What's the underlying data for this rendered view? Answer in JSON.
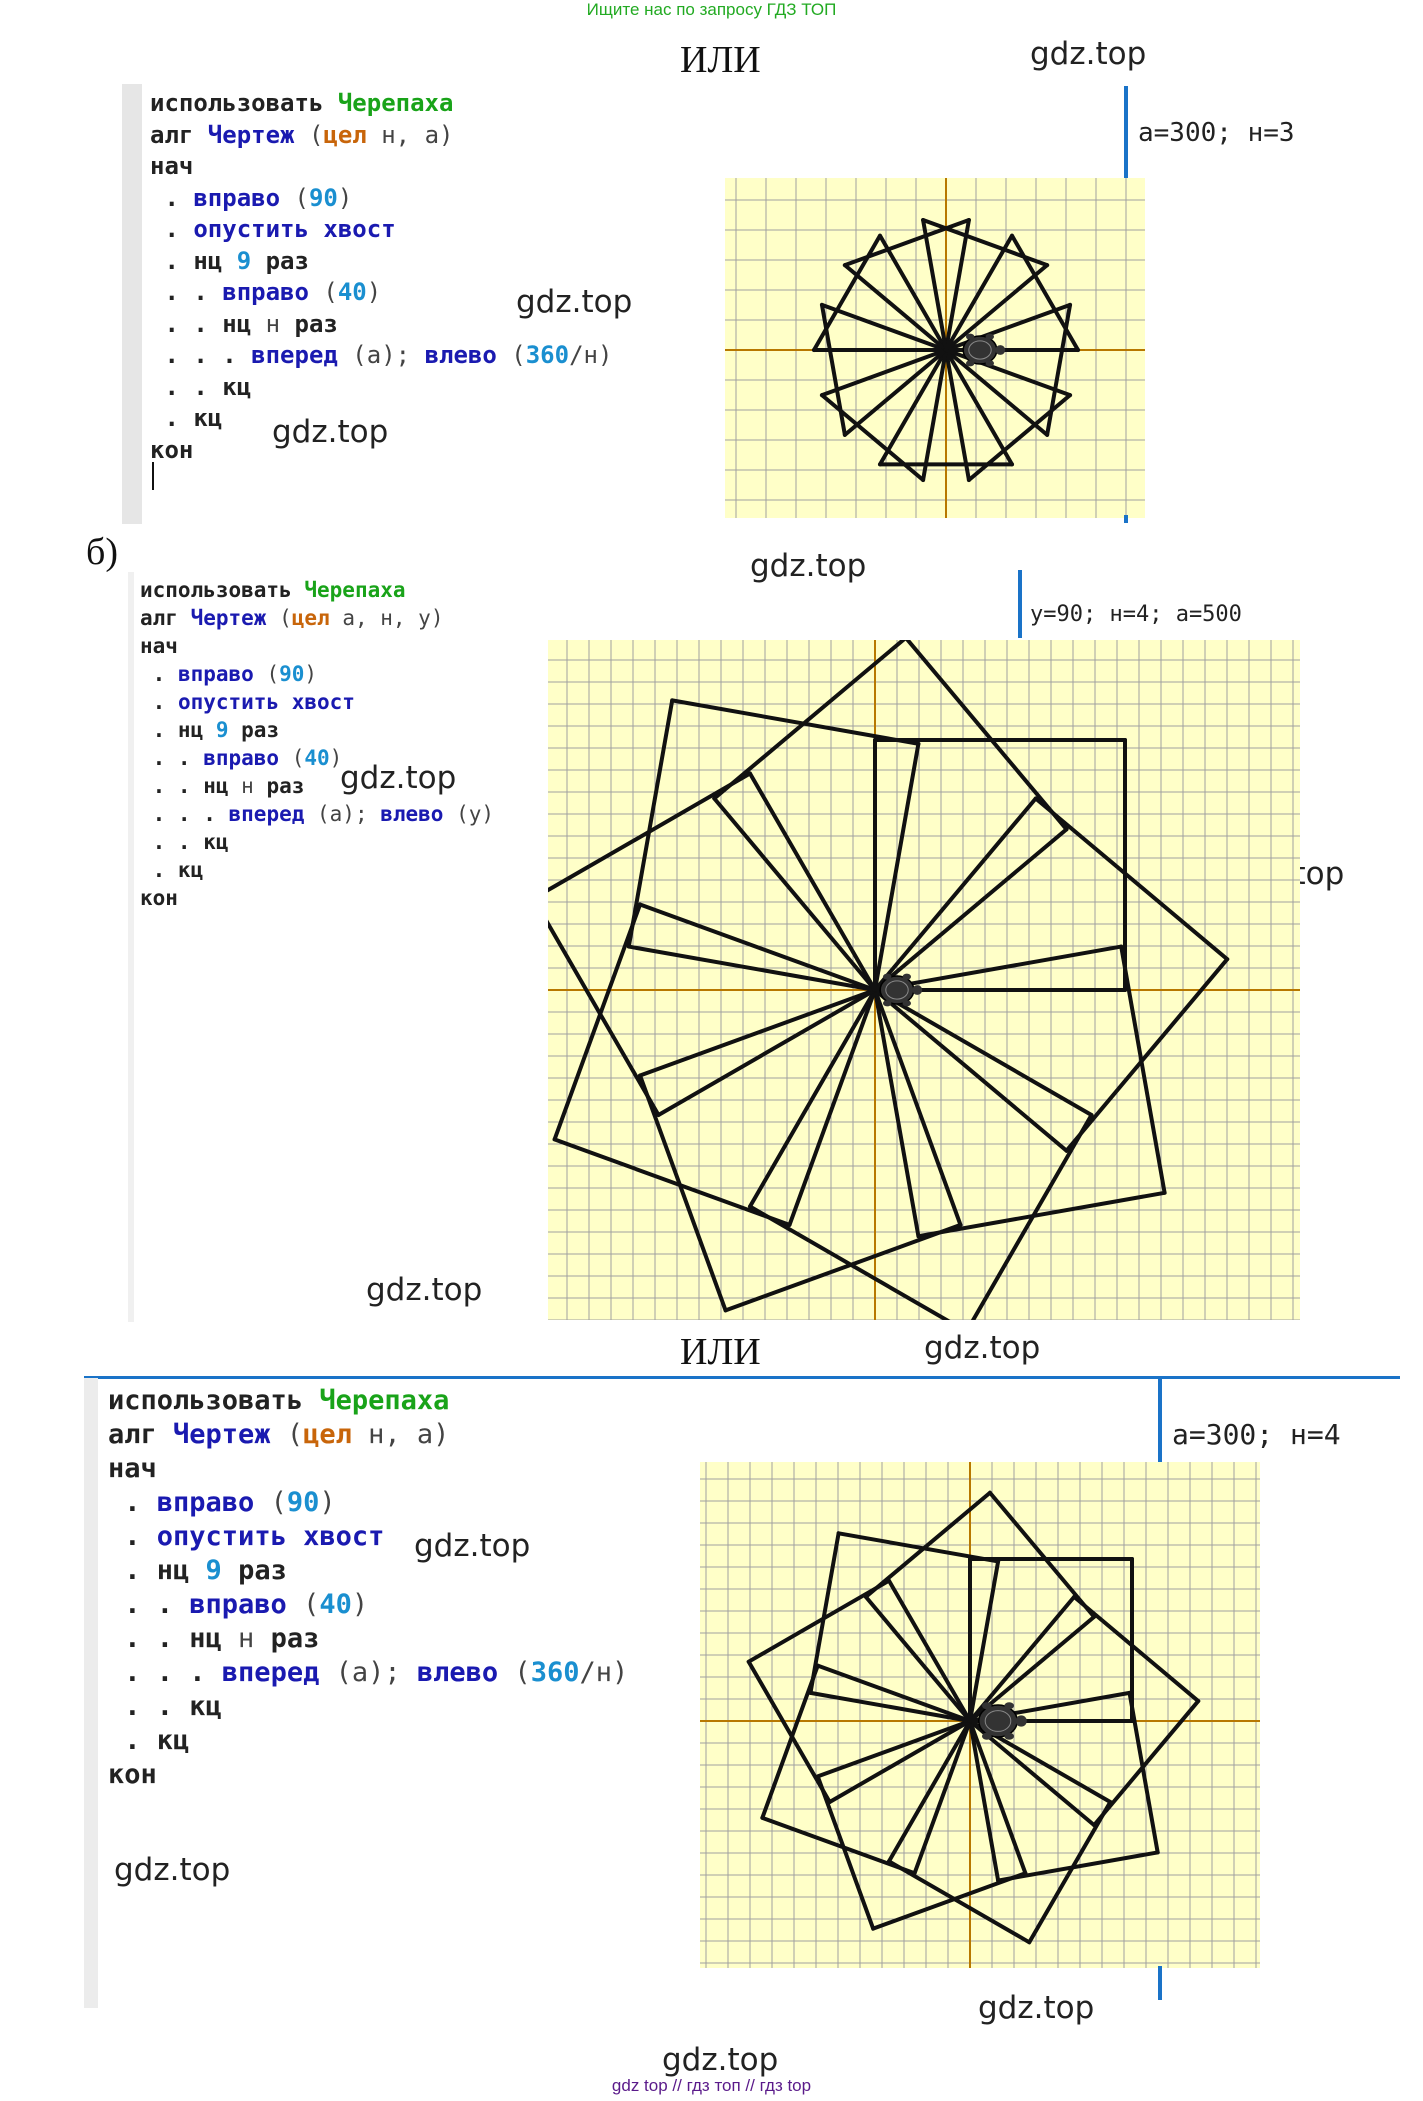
{
  "banner": "Ищите нас по запросу ГДЗ ТОП",
  "footer": "gdz top  //  гдз топ  //  гдз top",
  "or_label": "ИЛИ",
  "section_b_label": "б)",
  "watermark": "gdz.top",
  "block1": {
    "params": "a=300; н=3",
    "lines": [
      {
        "parts": [
          {
            "t": "использовать ",
            "c": "kw"
          },
          {
            "t": "Черепаха",
            "c": "grn"
          }
        ]
      },
      {
        "parts": [
          {
            "t": "алг ",
            "c": "kw"
          },
          {
            "t": "Чертеж",
            "c": "blu"
          },
          {
            "t": " (",
            "c": "plain"
          },
          {
            "t": "цел",
            "c": "org"
          },
          {
            "t": " н, а)",
            "c": "plain"
          }
        ]
      },
      {
        "parts": [
          {
            "t": "нач",
            "c": "kw"
          }
        ]
      },
      {
        "parts": [
          {
            "t": " . ",
            "c": "kw"
          },
          {
            "t": "вправо",
            "c": "blu"
          },
          {
            "t": " (",
            "c": "plain"
          },
          {
            "t": "90",
            "c": "num"
          },
          {
            "t": ")",
            "c": "plain"
          }
        ]
      },
      {
        "parts": [
          {
            "t": " . ",
            "c": "kw"
          },
          {
            "t": "опустить хвост",
            "c": "blu"
          }
        ]
      },
      {
        "parts": [
          {
            "t": " . нц ",
            "c": "kw"
          },
          {
            "t": "9",
            "c": "num"
          },
          {
            "t": " раз",
            "c": "kw"
          }
        ]
      },
      {
        "parts": [
          {
            "t": " . . ",
            "c": "kw"
          },
          {
            "t": "вправо",
            "c": "blu"
          },
          {
            "t": " (",
            "c": "plain"
          },
          {
            "t": "40",
            "c": "num"
          },
          {
            "t": ")",
            "c": "plain"
          }
        ]
      },
      {
        "parts": [
          {
            "t": " . . нц ",
            "c": "kw"
          },
          {
            "t": "н",
            "c": "plain"
          },
          {
            "t": " раз",
            "c": "kw"
          }
        ]
      },
      {
        "parts": [
          {
            "t": " . . . ",
            "c": "kw"
          },
          {
            "t": "вперед",
            "c": "blu"
          },
          {
            "t": " (а); ",
            "c": "plain"
          },
          {
            "t": "влево",
            "c": "blu"
          },
          {
            "t": " (",
            "c": "plain"
          },
          {
            "t": "360",
            "c": "num"
          },
          {
            "t": "/н)",
            "c": "plain"
          }
        ]
      },
      {
        "parts": [
          {
            "t": " . . кц",
            "c": "kw"
          }
        ]
      },
      {
        "parts": [
          {
            "t": " . кц",
            "c": "kw"
          }
        ]
      },
      {
        "parts": [
          {
            "t": "кон",
            "c": "kw"
          }
        ]
      }
    ]
  },
  "block2": {
    "params": "y=90; н=4; a=500",
    "lines": [
      {
        "parts": [
          {
            "t": "использовать ",
            "c": "kw"
          },
          {
            "t": "Черепаха",
            "c": "grn"
          }
        ]
      },
      {
        "parts": [
          {
            "t": "алг ",
            "c": "kw"
          },
          {
            "t": "Чертеж",
            "c": "blu"
          },
          {
            "t": " (",
            "c": "plain"
          },
          {
            "t": "цел",
            "c": "org"
          },
          {
            "t": " а, н, у)",
            "c": "plain"
          }
        ]
      },
      {
        "parts": [
          {
            "t": "нач",
            "c": "kw"
          }
        ]
      },
      {
        "parts": [
          {
            "t": " . ",
            "c": "kw"
          },
          {
            "t": "вправо",
            "c": "blu"
          },
          {
            "t": " (",
            "c": "plain"
          },
          {
            "t": "90",
            "c": "num"
          },
          {
            "t": ")",
            "c": "plain"
          }
        ]
      },
      {
        "parts": [
          {
            "t": " . ",
            "c": "kw"
          },
          {
            "t": "опустить хвост",
            "c": "blu"
          }
        ]
      },
      {
        "parts": [
          {
            "t": " . нц ",
            "c": "kw"
          },
          {
            "t": "9",
            "c": "num"
          },
          {
            "t": " раз",
            "c": "kw"
          }
        ]
      },
      {
        "parts": [
          {
            "t": " . . ",
            "c": "kw"
          },
          {
            "t": "вправо",
            "c": "blu"
          },
          {
            "t": " (",
            "c": "plain"
          },
          {
            "t": "40",
            "c": "num"
          },
          {
            "t": ")",
            "c": "plain"
          }
        ]
      },
      {
        "parts": [
          {
            "t": " . . нц ",
            "c": "kw"
          },
          {
            "t": "н",
            "c": "plain"
          },
          {
            "t": " раз",
            "c": "kw"
          }
        ]
      },
      {
        "parts": [
          {
            "t": " . . . ",
            "c": "kw"
          },
          {
            "t": "вперед",
            "c": "blu"
          },
          {
            "t": " (а); ",
            "c": "plain"
          },
          {
            "t": "влево",
            "c": "blu"
          },
          {
            "t": " (у)",
            "c": "plain"
          }
        ]
      },
      {
        "parts": [
          {
            "t": " . . кц",
            "c": "kw"
          }
        ]
      },
      {
        "parts": [
          {
            "t": " . кц",
            "c": "kw"
          }
        ]
      },
      {
        "parts": [
          {
            "t": "кон",
            "c": "kw"
          }
        ]
      }
    ]
  },
  "block3": {
    "params": "a=300; н=4",
    "lines": [
      {
        "parts": [
          {
            "t": "использовать ",
            "c": "kw"
          },
          {
            "t": "Черепаха",
            "c": "grn"
          }
        ]
      },
      {
        "parts": [
          {
            "t": "алг ",
            "c": "kw"
          },
          {
            "t": "Чертеж",
            "c": "blu"
          },
          {
            "t": " (",
            "c": "plain"
          },
          {
            "t": "цел",
            "c": "org"
          },
          {
            "t": " н, а)",
            "c": "plain"
          }
        ]
      },
      {
        "parts": [
          {
            "t": "нач",
            "c": "kw"
          }
        ]
      },
      {
        "parts": [
          {
            "t": " . ",
            "c": "kw"
          },
          {
            "t": "вправо",
            "c": "blu"
          },
          {
            "t": " (",
            "c": "plain"
          },
          {
            "t": "90",
            "c": "num"
          },
          {
            "t": ")",
            "c": "plain"
          }
        ]
      },
      {
        "parts": [
          {
            "t": " . ",
            "c": "kw"
          },
          {
            "t": "опустить хвост",
            "c": "blu"
          }
        ]
      },
      {
        "parts": [
          {
            "t": " . нц ",
            "c": "kw"
          },
          {
            "t": "9",
            "c": "num"
          },
          {
            "t": " раз",
            "c": "kw"
          }
        ]
      },
      {
        "parts": [
          {
            "t": " . . ",
            "c": "kw"
          },
          {
            "t": "вправо",
            "c": "blu"
          },
          {
            "t": " (",
            "c": "plain"
          },
          {
            "t": "40",
            "c": "num"
          },
          {
            "t": ")",
            "c": "plain"
          }
        ]
      },
      {
        "parts": [
          {
            "t": " . . нц ",
            "c": "kw"
          },
          {
            "t": "н",
            "c": "plain"
          },
          {
            "t": " раз",
            "c": "kw"
          }
        ]
      },
      {
        "parts": [
          {
            "t": " . . . ",
            "c": "kw"
          },
          {
            "t": "вперед",
            "c": "blu"
          },
          {
            "t": " (а); ",
            "c": "plain"
          },
          {
            "t": "влево",
            "c": "blu"
          },
          {
            "t": " (",
            "c": "plain"
          },
          {
            "t": "360",
            "c": "num"
          },
          {
            "t": "/н)",
            "c": "plain"
          }
        ]
      },
      {
        "parts": [
          {
            "t": " . . кц",
            "c": "kw"
          }
        ]
      },
      {
        "parts": [
          {
            "t": " . кц",
            "c": "kw"
          }
        ]
      },
      {
        "parts": [
          {
            "t": "кон",
            "c": "kw"
          }
        ]
      }
    ]
  },
  "turtle_drawings": [
    {
      "sides": 3,
      "repeats": 9,
      "turn_each_repeat_deg": 40
    },
    {
      "sides": 4,
      "repeats": 9,
      "turn_each_repeat_deg": 40
    },
    {
      "sides": 4,
      "repeats": 9,
      "turn_each_repeat_deg": 40
    }
  ],
  "colors": {
    "grid_bg": "#ffffc8",
    "grid_line": "#a0a0a0",
    "axis": "#b87800",
    "accent_line": "#1a73c8"
  }
}
